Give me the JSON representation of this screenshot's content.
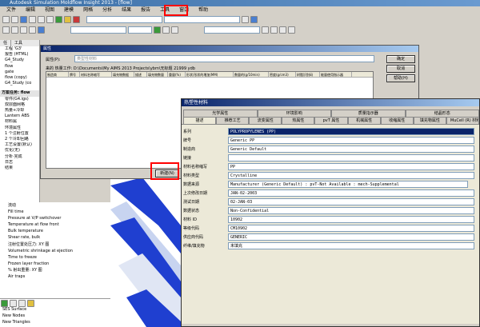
{
  "app": {
    "title": "Autodesk Simulation Moldflow Insight 2013 - [flow]"
  },
  "menu": [
    "文件",
    "编辑",
    "视图",
    "建模",
    "网格",
    "分析",
    "结果",
    "报告",
    "工具",
    "窗口",
    "帮助"
  ],
  "tools_menu_label": "工具",
  "left": {
    "tabs": [
      "任",
      "工具"
    ],
    "tree": [
      "工程 'G3'",
      "报告 (HTML)",
      "G4_Study",
      "flow",
      "gate",
      "flow (copy)",
      "G4_Study (co"
    ],
    "task_title": "方案任务: flow",
    "task_items": [
      "零件(G4.igs)",
      "双层面网格",
      "热量+冷却",
      "Lantern ABS",
      "材料属",
      "环境属性",
      "1 个注射位置",
      "2 个冷却回路",
      "工艺设置(默认)",
      "优化(无)",
      "分析·完成",
      "日志",
      "结果"
    ],
    "results": [
      "流动",
      "Fill time",
      "Pressure at V/P switchover",
      "Temperature at flow front",
      "Bulk temperature",
      "Shear rate, bulk",
      "注射位置处压力: XY 图",
      "Volumetric shrinkage at ejection",
      "Time to freeze",
      "Frozen layer fraction",
      "% 射出重量: XY 图",
      "Air traps"
    ],
    "bottom": [
      "SES Surface",
      "New Nodes",
      "New Triangles"
    ]
  },
  "dlg1": {
    "title": "属性",
    "name_label": "属性(P):",
    "name_value": "类型性材料",
    "path_label": "来的 热量工作:",
    "path_value": "D:\\Documents\\My AIMS 2013 Projects\\ybm\\无标题 21999 ydb",
    "buttons": [
      "确定",
      "取消",
      "帮助(H)"
    ],
    "new_button": "新建(N)",
    "columns": [
      "制造商",
      "牌号",
      "材料名称缩写",
      "填充物数据",
      "描述",
      "填充物数量",
      "重量(%)",
      "形状/形状的增加(MM)",
      "数量的(g/10min)",
      "密度(g/cm3)",
      "树脂识别码",
      "能量使用指示器"
    ]
  },
  "dlg2": {
    "title": "热塑性材料",
    "tabs_row1": [
      "光学属性",
      "环境影响",
      "质量指示器",
      "结晶形态"
    ],
    "tabs_row2": [
      "描述",
      "推荐工艺",
      "流变属性",
      "热属性",
      "pvT 属性",
      "机械属性",
      "收缩属性",
      "填充物属性",
      "MuCell (R) 材料属性"
    ],
    "fields": [
      {
        "label": "系列",
        "value": "POLYPROPYLENES (PP)",
        "sel": true
      },
      {
        "label": "牌号",
        "value": "Generic PP",
        "sel": false
      },
      {
        "label": "制造商",
        "value": "Generic Default",
        "sel": false
      },
      {
        "label": "链接",
        "value": "",
        "sel": false
      },
      {
        "label": "材料名称缩写",
        "value": "PP",
        "sel": false
      },
      {
        "label": "材料类型",
        "value": "Crystalline",
        "sel": false
      },
      {
        "label": "数据来源",
        "value": "Manufacturer (Generic Default) : pvT-Not Available : mech-Supplemental",
        "sel": false
      },
      {
        "label": "上次修改日期",
        "value": "JAN-02-2003",
        "sel": false
      },
      {
        "label": "测试日期",
        "value": "02-JAN-03",
        "sel": false
      },
      {
        "label": "数据状态",
        "value": "Non-Confidential",
        "sel": false
      },
      {
        "label": "材料 ID",
        "value": "10902",
        "sel": false
      },
      {
        "label": "等级代码",
        "value": "CM10902",
        "sel": false
      },
      {
        "label": "供应商代码",
        "value": "GENERIC",
        "sel": false
      },
      {
        "label": "纤维/填充物",
        "value": "未填充",
        "sel": false
      }
    ]
  }
}
